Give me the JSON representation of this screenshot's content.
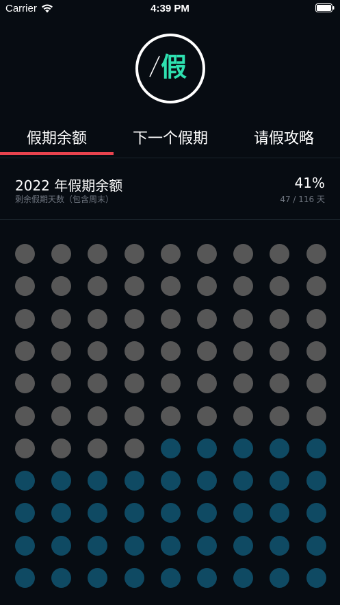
{
  "status_bar": {
    "carrier": "Carrier",
    "time": "4:39 PM"
  },
  "logo": {
    "char": "假"
  },
  "tabs": [
    {
      "label": "假期余额",
      "active": true
    },
    {
      "label": "下一个假期",
      "active": false
    },
    {
      "label": "请假攻略",
      "active": false
    }
  ],
  "summary": {
    "title": "2022 年假期余额",
    "subtitle": "剩余假期天数（包含周末）",
    "percent": "41%",
    "count": "47 / 116 天"
  },
  "dots": {
    "total": 99,
    "remaining": 41,
    "used_color": "#575757",
    "remaining_color": "#0f4a63"
  },
  "colors": {
    "accent": "#e8434e",
    "logo_char": "#2ee0b0",
    "background": "#070c12"
  }
}
